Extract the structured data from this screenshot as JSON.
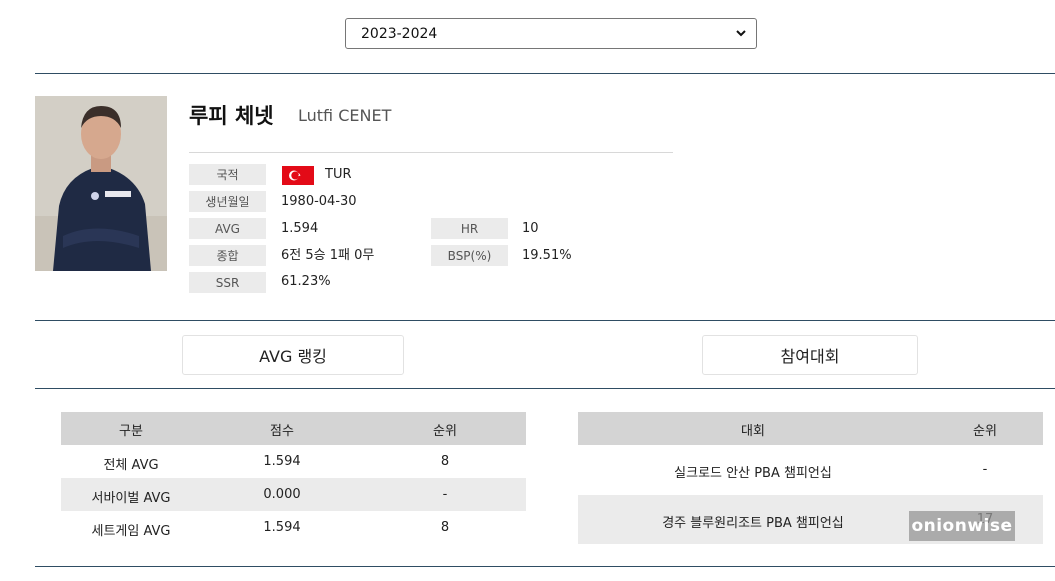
{
  "season_select": {
    "value": "2023-2024"
  },
  "player": {
    "name_ko": "루피 체넷",
    "name_en": "Lutfi CENET",
    "photo_icon": "player-photo",
    "info": {
      "nationality_label": "국적",
      "nationality_value": "TUR",
      "flag_icon": "turkey-flag-icon",
      "birth_label": "생년월일",
      "birth_value": "1980-04-30",
      "avg_label": "AVG",
      "avg_value": "1.594",
      "hr_label": "HR",
      "hr_value": "10",
      "total_label": "종합",
      "total_value": "6전 5승 1패 0무",
      "bsp_label": "BSP(%)",
      "bsp_value": "19.51%",
      "ssr_label": "SSR",
      "ssr_value": "61.23%"
    }
  },
  "tabs": {
    "avg_ranking": "AVG 랭킹",
    "tournaments": "참여대회"
  },
  "avg_table": {
    "headers": [
      "구분",
      "점수",
      "순위"
    ],
    "rows": [
      [
        "전체 AVG",
        "1.594",
        "8"
      ],
      [
        "서바이벌 AVG",
        "0.000",
        "-"
      ],
      [
        "세트게임 AVG",
        "1.594",
        "8"
      ]
    ]
  },
  "tournament_table": {
    "headers": [
      "대회",
      "순위"
    ],
    "rows": [
      [
        "실크로드 안산 PBA 챔피언십",
        "-"
      ],
      [
        "경주 블루원리조트 PBA 챔피언십",
        "17"
      ]
    ]
  },
  "watermark": "onionwise",
  "colors": {
    "rule_line": "#2f4d63",
    "table_header": "#d4d4d4",
    "label_bg": "#ebebeb",
    "flag_red": "#e30a17"
  }
}
